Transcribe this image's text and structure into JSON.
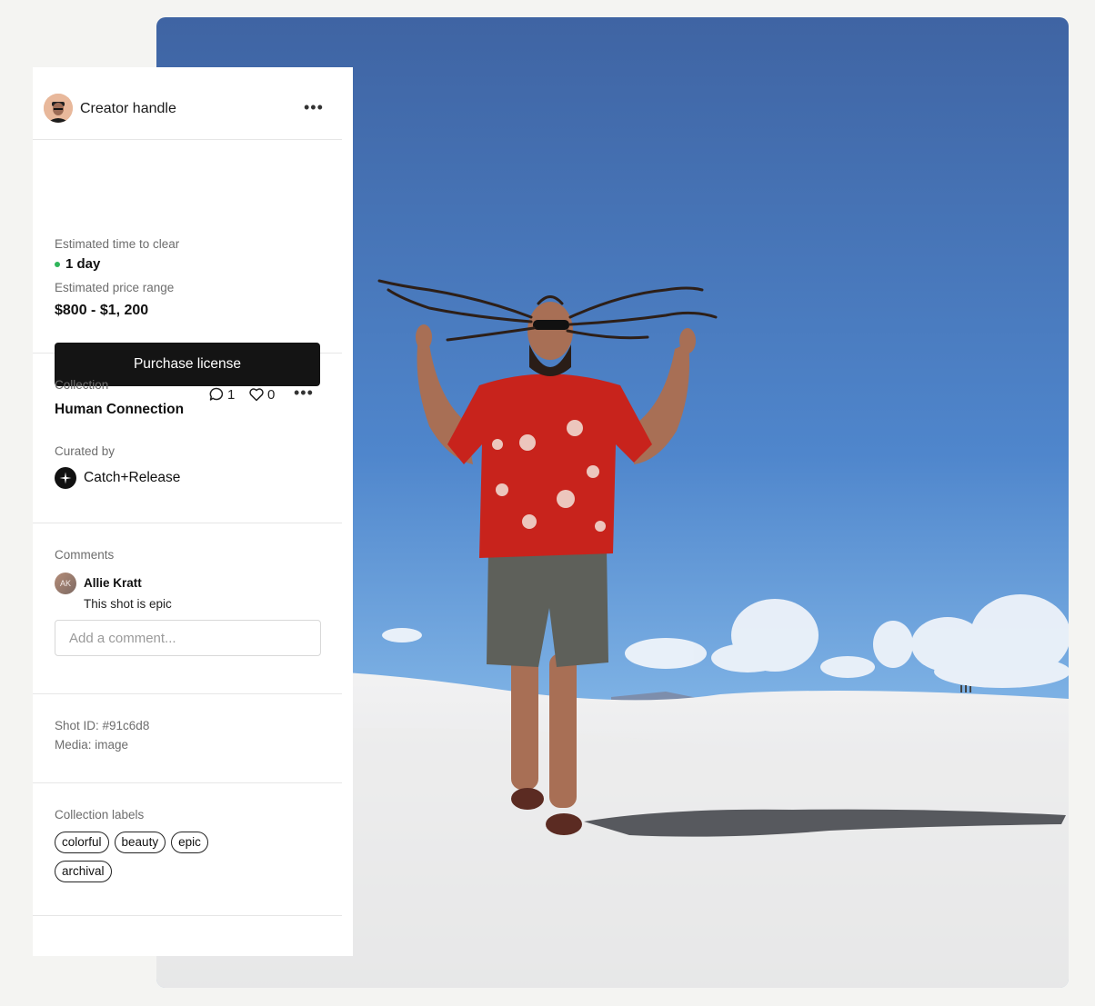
{
  "creator": {
    "name": "Creator handle",
    "more_icon": "more-horizontal-icon"
  },
  "licensing": {
    "time_label": "Estimated time to clear",
    "time_value": "1 day",
    "status_color": "#2fb55a",
    "price_label": "Estimated price range",
    "price_value": "$800 - $1, 200",
    "purchase_label": "Purchase license"
  },
  "collection": {
    "label": "Collection",
    "name": "Human Connection",
    "comment_count": "1",
    "like_count": "0",
    "curated_label": "Curated by",
    "curator": "Catch+Release"
  },
  "comments": {
    "label": "Comments",
    "items": [
      {
        "initials": "AK",
        "author": "Allie Kratt",
        "text": "This shot is epic"
      }
    ],
    "input_placeholder": "Add a comment..."
  },
  "meta": {
    "shot_id": "Shot ID: #91c6d8",
    "media": "Media: image"
  },
  "labels": {
    "title": "Collection labels",
    "tags": [
      "colorful",
      "beauty",
      "epic",
      "archival"
    ]
  },
  "colors": {
    "button_bg": "#141414",
    "panel_bg": "#ffffff",
    "page_bg": "#f4f4f2"
  }
}
